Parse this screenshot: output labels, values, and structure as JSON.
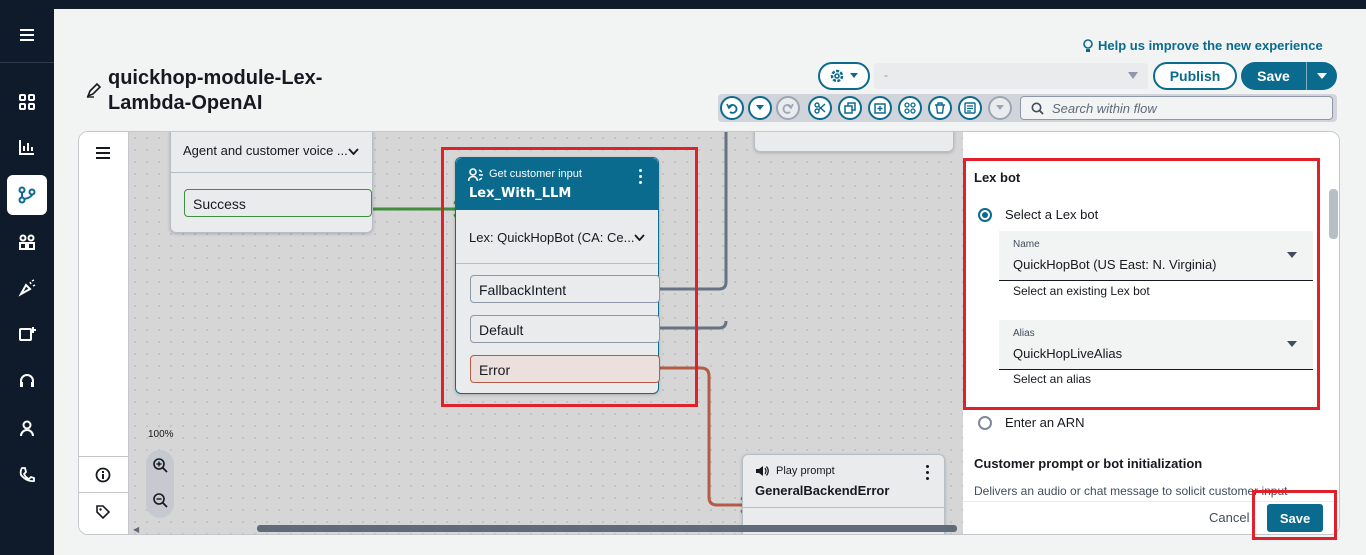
{
  "header": {
    "help_link": "Help us improve the new experience",
    "title": "quickhop-module-Lex-Lambda-OpenAI",
    "title_line1": "quickhop-module-Lex-",
    "title_line2": "Lambda-OpenAI",
    "version_value": "-",
    "publish_label": "Publish",
    "save_label": "Save",
    "search_placeholder": "Search within flow"
  },
  "canvas": {
    "zoom": "100%",
    "prev_block": {
      "dropdown": "Agent and customer voice ...",
      "branch": "Success"
    },
    "main_block": {
      "type": "Get customer input",
      "name": "Lex_With_LLM",
      "config": "Lex: QuickHopBot (CA: Ce...",
      "branches": [
        "FallbackIntent",
        "Default",
        "Error"
      ]
    },
    "play_block": {
      "type": "Play prompt",
      "name": "GeneralBackendError"
    }
  },
  "panel": {
    "section_title": "Lex bot",
    "radio_select": "Select a Lex bot",
    "name_label": "Name",
    "name_value": "QuickHopBot (US East: N. Virginia)",
    "name_hint": "Select an existing Lex bot",
    "alias_label": "Alias",
    "alias_value": "QuickHopLiveAlias",
    "alias_hint": "Select an alias",
    "radio_arn": "Enter an ARN",
    "prompt_title": "Customer prompt or bot initialization",
    "prompt_desc": "Delivers an audio or chat message to solicit customer input",
    "cancel_label": "Cancel",
    "save_label": "Save"
  },
  "colors": {
    "nav_bg": "#0f1b2a",
    "accent": "#0b6b8f",
    "highlight": "#e0202a",
    "success_connector": "#3f8f3f",
    "error_connector": "#b35c47"
  }
}
